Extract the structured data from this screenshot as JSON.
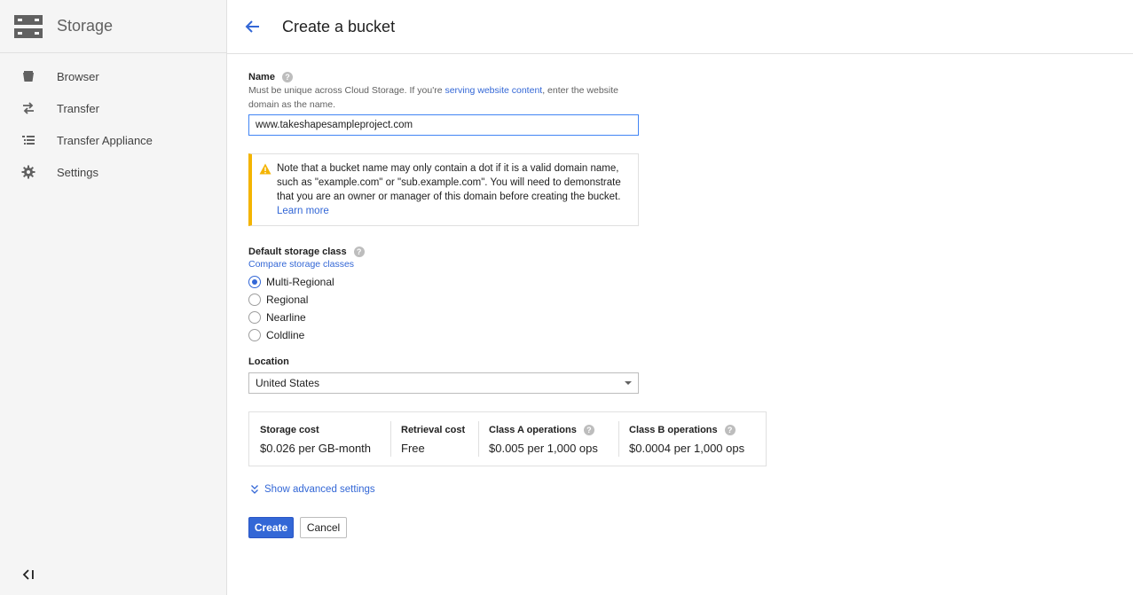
{
  "sidebar": {
    "title": "Storage",
    "items": [
      {
        "label": "Browser",
        "icon": "bucket-icon"
      },
      {
        "label": "Transfer",
        "icon": "transfer-arrows-icon"
      },
      {
        "label": "Transfer Appliance",
        "icon": "list-icon"
      },
      {
        "label": "Settings",
        "icon": "gear-icon"
      }
    ],
    "collapse_icon": "collapse-sidebar-icon"
  },
  "header": {
    "title": "Create a bucket",
    "back_icon": "back-arrow-icon"
  },
  "form": {
    "name": {
      "label": "Name",
      "hint_before": "Must be unique across Cloud Storage. If you're ",
      "hint_link": "serving website content",
      "hint_after": ", enter the website domain as the name.",
      "value": "www.takeshapesampleproject.com"
    },
    "warning": {
      "text": "Note that a bucket name may only contain a dot if it is a valid domain name, such as \"example.com\" or \"sub.example.com\". You will need to demonstrate that you are an owner or manager of this domain before creating the bucket.",
      "link": "Learn more",
      "accent_color": "#f4b400"
    },
    "storage_class": {
      "label": "Default storage class",
      "compare_link": "Compare storage classes",
      "options": [
        "Multi-Regional",
        "Regional",
        "Nearline",
        "Coldline"
      ],
      "selected": "Multi-Regional"
    },
    "location": {
      "label": "Location",
      "value": "United States"
    },
    "costs": [
      {
        "header": "Storage cost",
        "value": "$0.026 per GB-month",
        "help": false
      },
      {
        "header": "Retrieval cost",
        "value": "Free",
        "help": false
      },
      {
        "header": "Class A operations",
        "value": "$0.005 per 1,000 ops",
        "help": true
      },
      {
        "header": "Class B operations",
        "value": "$0.0004 per 1,000 ops",
        "help": true
      }
    ],
    "advanced_link": "Show advanced settings",
    "create_label": "Create",
    "cancel_label": "Cancel"
  },
  "colors": {
    "accent": "#3367d6",
    "sidebar_bg": "#f5f5f5",
    "warning": "#f4b400"
  }
}
